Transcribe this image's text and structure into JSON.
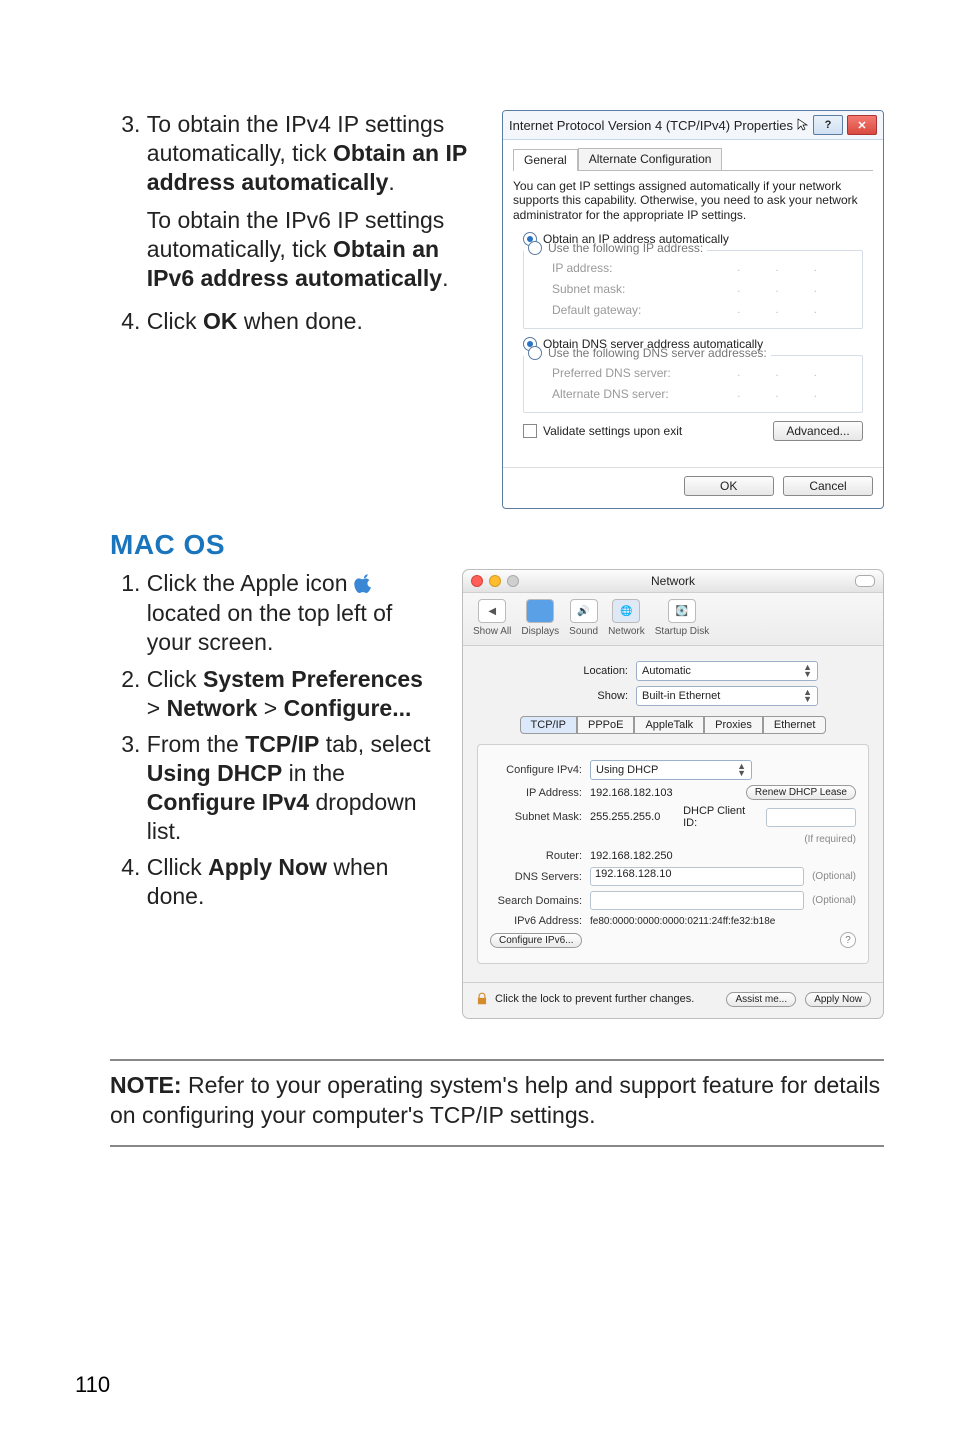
{
  "steps_top": [
    {
      "prefix": "To obtain the IPv4 IP settings automatically, tick ",
      "bold": "Obtain an IP address automatically",
      "suffix": "."
    },
    {
      "prefix": "To obtain the IPv6 IP settings automatically, tick ",
      "bold": "Obtain an IPv6 address automatically",
      "suffix": "."
    },
    {
      "prefix": "Click ",
      "bold": "OK",
      "suffix": " when done."
    }
  ],
  "mac_heading": "MAC OS",
  "mac_steps": {
    "s1": {
      "p1": "Click the Apple icon ",
      "p2": " located on the top left of your screen."
    },
    "s2": {
      "p1": "Click ",
      "b1": "System Preferences",
      "gt1": " > ",
      "b2": "Network",
      "gt2": " > ",
      "b3": "Configure..."
    },
    "s3": {
      "p1": "From the ",
      "b1": "TCP/IP",
      "p2": " tab, select ",
      "b2": "Using DHCP",
      "p3": " in the ",
      "b3": "Configure IPv4",
      "p4": " dropdown list."
    },
    "s4": {
      "p1": "Cllick ",
      "b1": "Apply Now",
      "p2": " when done."
    }
  },
  "note": {
    "label": "NOTE:",
    "text": " Refer to your operating system's help and support feature for details on configuring your computer's TCP/IP settings."
  },
  "page_number": "110",
  "win": {
    "title": "Internet Protocol Version 4 (TCP/IPv4) Properties",
    "help": "?",
    "close": "✕",
    "tabs": [
      "General",
      "Alternate Configuration"
    ],
    "desc": "You can get IP settings assigned automatically if your network supports this capability. Otherwise, you need to ask your network administrator for the appropriate IP settings.",
    "ip_auto": "Obtain an IP address automatically",
    "ip_manual": "Use the following IP address:",
    "ip_fields": [
      "IP address:",
      "Subnet mask:",
      "Default gateway:"
    ],
    "dns_auto": "Obtain DNS server address automatically",
    "dns_manual": "Use the following DNS server addresses:",
    "dns_fields": [
      "Preferred DNS server:",
      "Alternate DNS server:"
    ],
    "validate": "Validate settings upon exit",
    "advanced": "Advanced...",
    "ok": "OK",
    "cancel": "Cancel"
  },
  "mac": {
    "window_title": "Network",
    "toolbar": [
      "Show All",
      "Displays",
      "Sound",
      "Network",
      "Startup Disk"
    ],
    "location_label": "Location:",
    "location_value": "Automatic",
    "show_label": "Show:",
    "show_value": "Built-in Ethernet",
    "tabs": [
      "TCP/IP",
      "PPPoE",
      "AppleTalk",
      "Proxies",
      "Ethernet"
    ],
    "cfg_label": "Configure IPv4:",
    "cfg_value": "Using DHCP",
    "ip_label": "IP Address:",
    "ip_value": "192.168.182.103",
    "renew": "Renew DHCP Lease",
    "subnet_label": "Subnet Mask:",
    "subnet_value": "255.255.255.0",
    "dhcpid_label": "DHCP Client ID:",
    "dhcpid_hint": "(If required)",
    "router_label": "Router:",
    "router_value": "192.168.182.250",
    "dns_label": "DNS Servers:",
    "dns_value": "192.168.128.10",
    "optional": "(Optional)",
    "search_label": "Search Domains:",
    "ipv6addr_label": "IPv6 Address:",
    "ipv6addr_value": "fe80:0000:0000:0000:0211:24ff:fe32:b18e",
    "cfg6_btn": "Configure IPv6...",
    "lock_text": "Click the lock to prevent further changes.",
    "assist": "Assist me...",
    "apply": "Apply Now",
    "q": "?"
  }
}
